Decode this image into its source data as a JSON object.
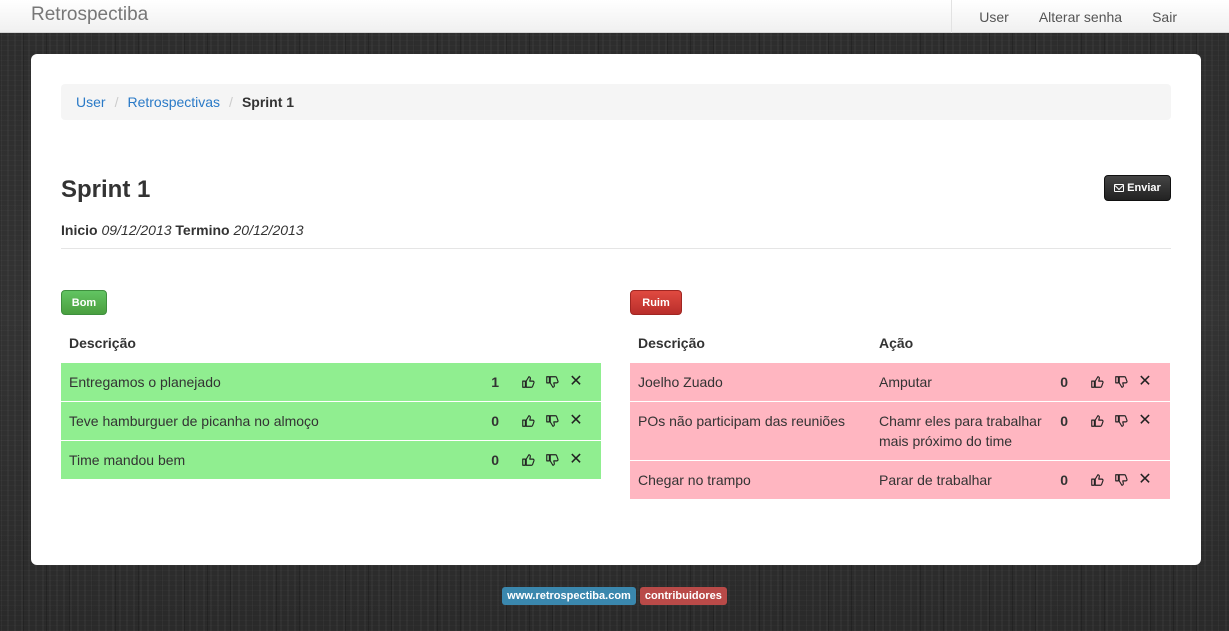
{
  "navbar": {
    "brand": "Retrospectiba",
    "links": [
      "User",
      "Alterar senha",
      "Sair"
    ]
  },
  "breadcrumb": {
    "items": [
      "User",
      "Retrospectivas"
    ],
    "active": "Sprint 1"
  },
  "page": {
    "title": "Sprint 1",
    "send_label": "Enviar",
    "inicio_label": "Inicio",
    "inicio_value": "09/12/2013",
    "termino_label": "Termino",
    "termino_value": "20/12/2013"
  },
  "bom": {
    "label": "Bom",
    "header_descricao": "Descrição",
    "rows": [
      {
        "descricao": "Entregamos o planejado",
        "count": "1"
      },
      {
        "descricao": "Teve hamburguer de picanha no almoço",
        "count": "0"
      },
      {
        "descricao": "Time mandou bem",
        "count": "0"
      }
    ]
  },
  "ruim": {
    "label": "Ruim",
    "header_descricao": "Descrição",
    "header_acao": "Ação",
    "rows": [
      {
        "descricao": "Joelho Zuado",
        "acao": "Amputar",
        "count": "0"
      },
      {
        "descricao": "POs não participam das reuniões",
        "acao": "Chamr eles para trabalhar mais próximo do time",
        "count": "0"
      },
      {
        "descricao": "Chegar no trampo",
        "acao": "Parar de trabalhar",
        "count": "0"
      }
    ]
  },
  "footer": {
    "site_link": "www.retrospectiba.com",
    "contrib_link": "contribuidores"
  },
  "icons": {
    "thumb_up": "thumbs-up-icon",
    "thumb_down": "thumbs-down-icon",
    "remove": "close-icon",
    "close_glyph": "✕",
    "send": "envelope-icon"
  },
  "colors": {
    "bom_row": "#90ee90",
    "ruim_row": "#ffb6c1",
    "link": "#2a7ac7",
    "bom_label": "#5bb75b",
    "ruim_label": "#da4f49"
  }
}
